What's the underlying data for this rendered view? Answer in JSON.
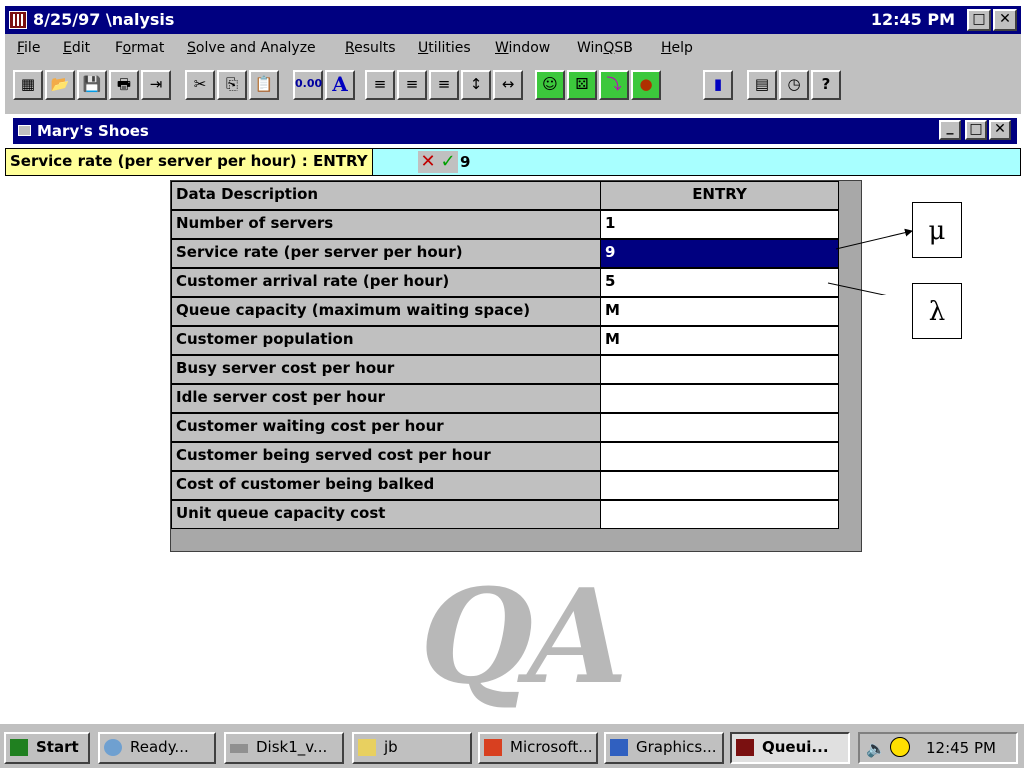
{
  "window": {
    "title": "8/25/97 \\nalysis",
    "clock": "12:45 PM",
    "restore": "□",
    "close": "✕"
  },
  "menu": [
    {
      "label": "File",
      "u": "F",
      "rest": "ile"
    },
    {
      "label": "Edit",
      "u": "E",
      "rest": "dit"
    },
    {
      "label": "Format",
      "pre": "F",
      "u": "o",
      "rest": "rmat"
    },
    {
      "label": "Solve and Analyze",
      "u": "S",
      "rest": "olve and Analyze"
    },
    {
      "label": "Results",
      "u": "R",
      "rest": "esults"
    },
    {
      "label": "Utilities",
      "u": "U",
      "rest": "tilities"
    },
    {
      "label": "Window",
      "u": "W",
      "rest": "indow"
    },
    {
      "label": "WinQSB",
      "pre": "Win",
      "u": "Q",
      "rest": "SB"
    },
    {
      "label": "Help",
      "u": "H",
      "rest": "elp"
    }
  ],
  "toolbar": {
    "number_format": "0.00",
    "font": "A"
  },
  "document": {
    "title": "Mary's Shoes",
    "minimize": "_",
    "restore": "□",
    "close": "✕",
    "entry_label": "Service rate (per server per hour) : ENTRY",
    "entry_cancel": "✕",
    "entry_accept": "✓",
    "entry_value": "9"
  },
  "grid": {
    "header": [
      "Data Description",
      "ENTRY"
    ],
    "rows": [
      {
        "desc": "Number of servers",
        "value": "1"
      },
      {
        "desc": "Service rate (per server per hour)",
        "value": "9"
      },
      {
        "desc": "Customer arrival rate (per hour)",
        "value": "5"
      },
      {
        "desc": "Queue capacity (maximum waiting space)",
        "value": "M"
      },
      {
        "desc": "Customer population",
        "value": "M"
      },
      {
        "desc": "Busy server cost per hour",
        "value": ""
      },
      {
        "desc": "Idle server cost per hour",
        "value": ""
      },
      {
        "desc": "Customer waiting cost per hour",
        "value": ""
      },
      {
        "desc": "Customer being served cost per hour",
        "value": ""
      },
      {
        "desc": "Cost of customer being balked",
        "value": ""
      },
      {
        "desc": "Unit queue capacity cost",
        "value": ""
      }
    ]
  },
  "annotations": {
    "mu": "μ",
    "lambda": "λ"
  },
  "watermark": "QA",
  "taskbar": {
    "start": "Start",
    "tasks": [
      "Ready...",
      "Disk1_v...",
      "jb",
      "Microsoft...",
      "Graphics...",
      "Queui..."
    ],
    "clock": "12:45 PM"
  }
}
